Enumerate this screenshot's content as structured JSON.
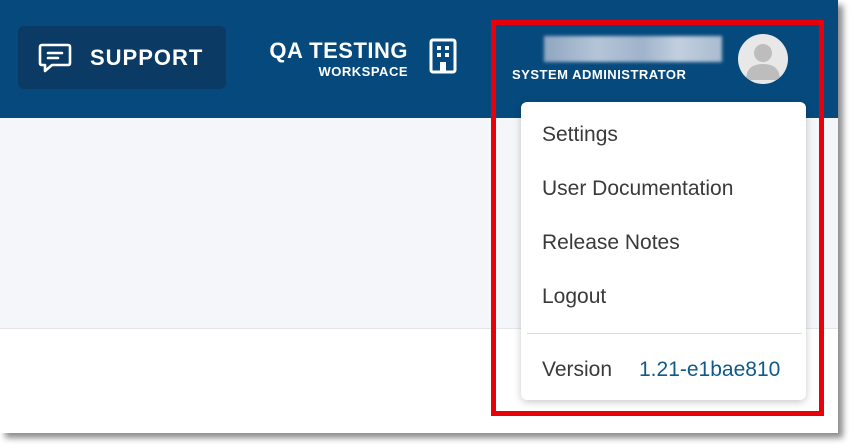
{
  "header": {
    "support_label": "SUPPORT",
    "workspace_name": "QA TESTING",
    "workspace_type": "WORKSPACE",
    "user_role": "SYSTEM ADMINISTRATOR"
  },
  "user_menu": {
    "items": [
      {
        "label": "Settings"
      },
      {
        "label": "User Documentation"
      },
      {
        "label": "Release Notes"
      },
      {
        "label": "Logout"
      }
    ],
    "version_label": "Version",
    "version_value": "1.21-e1bae810"
  },
  "icons": {
    "support": "chat-bubble-icon",
    "workspace": "building-icon",
    "avatar": "user-silhouette-icon"
  },
  "colors": {
    "topbar": "#064a7d",
    "support_button": "#0b3a64",
    "version_link": "#0e5a8a",
    "highlight_border": "#e8000b"
  }
}
